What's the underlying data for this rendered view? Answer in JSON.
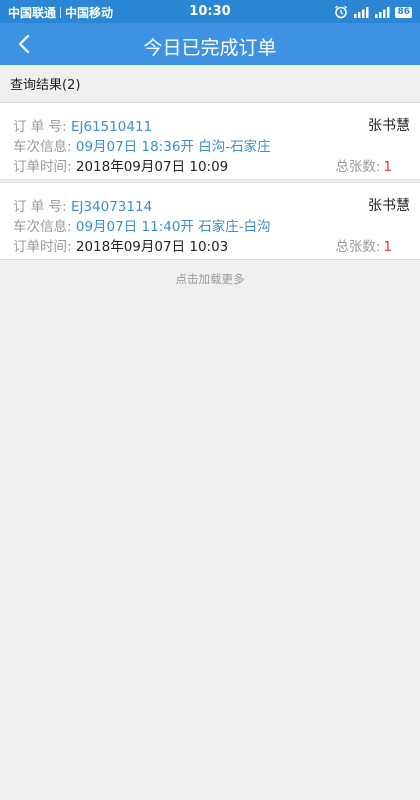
{
  "status_bar": {
    "carrier1": "中国联通",
    "carrier2": "中国移动",
    "time": "10:30",
    "battery": "86"
  },
  "nav": {
    "title": "今日已完成订单"
  },
  "results": {
    "label": "查询结果(2)"
  },
  "labels": {
    "order_no": "订 单 号:",
    "train_info": "车次信息:",
    "order_time": "订单时间:",
    "total_tickets": "总张数:"
  },
  "orders": [
    {
      "order_no": "EJ61510411",
      "train_info": "09月07日 18:36开 白沟-石家庄",
      "order_time": "2018年09月07日 10:09",
      "passenger": "张书慧",
      "total": "1"
    },
    {
      "order_no": "EJ34073114",
      "train_info": "09月07日 11:40开 石家庄-白沟",
      "order_time": "2018年09月07日 10:03",
      "passenger": "张书慧",
      "total": "1"
    }
  ],
  "load_more": "点击加载更多",
  "colors": {
    "status_bar": "#2b86d4",
    "nav_bar": "#3d92e2",
    "link_blue": "#3a8ed1",
    "count_red": "#e23b36"
  }
}
